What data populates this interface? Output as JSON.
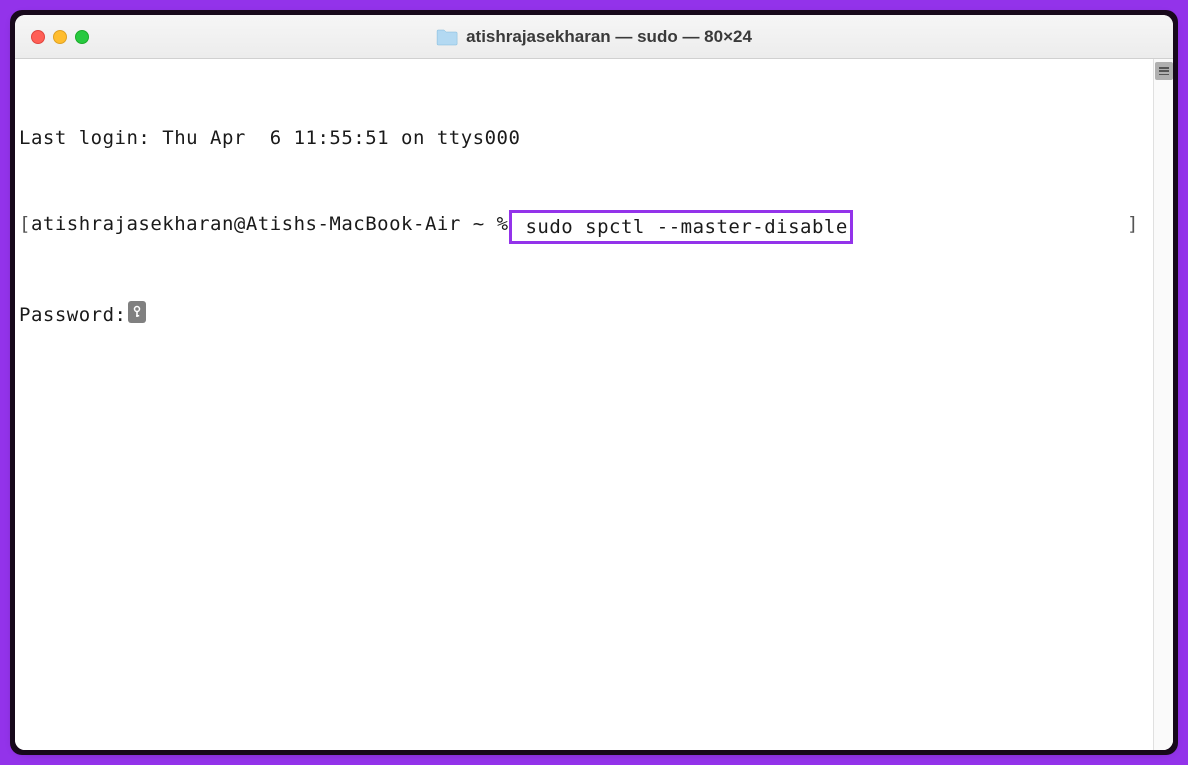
{
  "window": {
    "title": "atishrajasekharan — sudo — 80×24"
  },
  "terminal": {
    "last_login": "Last login: Thu Apr  6 11:55:51 on ttys000",
    "prompt_open": "[",
    "prompt_user": "atishrajasekharan@Atishs-MacBook-Air ~ %",
    "command": " sudo spctl --master-disable",
    "prompt_close": "]",
    "password_label": "Password:"
  }
}
